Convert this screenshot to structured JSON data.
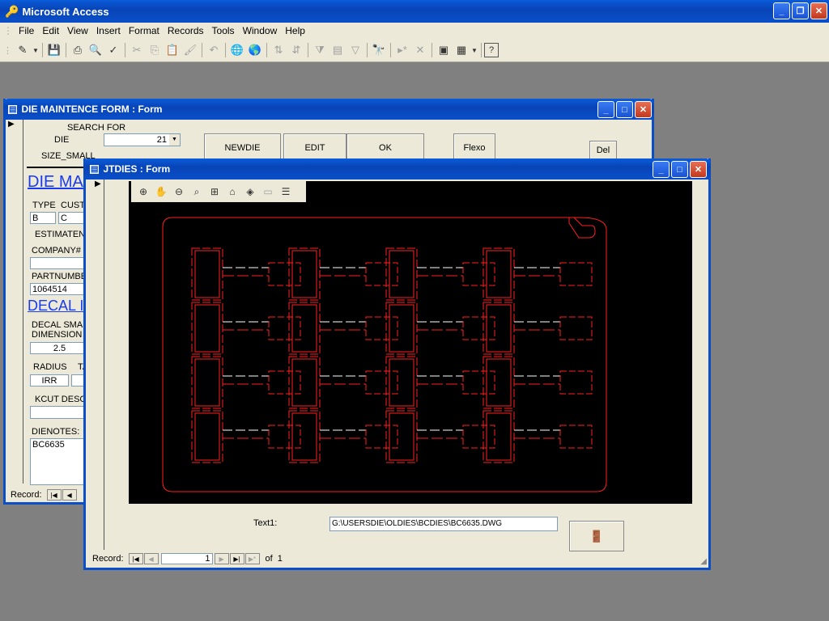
{
  "app": {
    "title": "Microsoft Access",
    "menu": [
      "File",
      "Edit",
      "View",
      "Insert",
      "Format",
      "Records",
      "Tools",
      "Window",
      "Help"
    ]
  },
  "colors": {
    "titlebar": "#0a4fc8",
    "workspace": "#808080",
    "drawing_line": "#ff2020",
    "canvas_bg": "#000000"
  },
  "die_form": {
    "title": "DIE MAINTENCE FORM : Form",
    "search_for": "SEARCH FOR",
    "die_label": "DIE",
    "die_value": "21",
    "size_small_label": "SIZE_SMALL",
    "buttons": {
      "newdie": "NEWDIE",
      "edit": "EDIT",
      "ok": "OK",
      "flexo": "Flexo",
      "del": "Del"
    },
    "heading1": "DIE MA",
    "type_label": "TYPE",
    "custo_label": "CUSTO",
    "type_value": "B",
    "custo_value": "C",
    "estimaten_label": "ESTIMATEN",
    "company_label": "COMPANY#",
    "company_value": "",
    "partnumber_label": "PARTNUMBE",
    "partnumber_value": "1064514",
    "heading2": "DECAL I",
    "decal_small_label": "DECAL SMAL",
    "dimension_label": "DIMENSION",
    "dimension_value": "2.5",
    "radius_label": "RADIUS",
    "ta_label": "TA",
    "radius_value": "IRR",
    "kcut_label": "KCUT DESC",
    "dienotes_label": "DIENOTES:",
    "dienotes_value": "BC6635",
    "record_label": "Record:"
  },
  "jtdies_form": {
    "title": "JTDIES : Form",
    "text1_label": "Text1:",
    "text1_value": "G:\\USERSDIE\\OLDIES\\BCDIES\\BC6635.DWG",
    "record_label": "Record:",
    "record_current": "1",
    "record_of": "of",
    "record_total": "1",
    "viewer_tools": [
      "zoom-in-icon",
      "pan-icon",
      "zoom-out-icon",
      "zoom-window-icon",
      "zoom-extents-icon",
      "home-view-icon",
      "3d-view-icon",
      "page-icon",
      "layers-icon"
    ]
  },
  "drawing": {
    "rows": 4,
    "cols": 4
  }
}
